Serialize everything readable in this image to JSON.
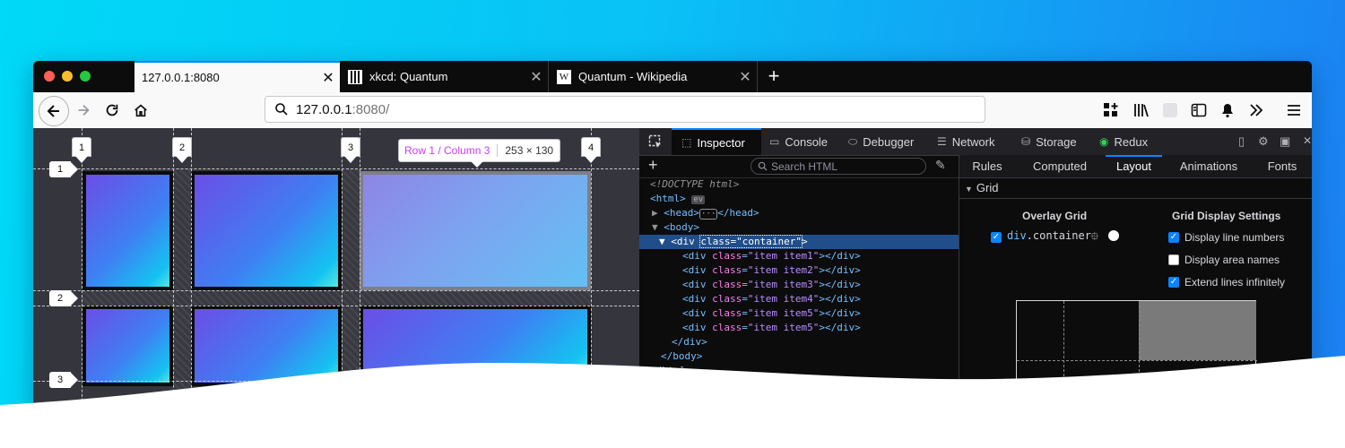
{
  "browser": {
    "tabs": [
      {
        "title": "127.0.0.1:8080",
        "active": true
      },
      {
        "title": "xkcd: Quantum",
        "active": false,
        "favicon": "xkcd-favicon"
      },
      {
        "title": "Quantum - Wikipedia",
        "active": false,
        "favicon": "wikipedia-favicon"
      }
    ],
    "tab_close_symbol": "✕",
    "new_tab_symbol": "+",
    "url_host": "127.0.0.1",
    "url_rest": ":8080/",
    "toolbar_icons": [
      "back-icon",
      "forward-icon",
      "reload-icon",
      "home-icon",
      "extensions-icon",
      "library-icon",
      "container-icon",
      "sidebar-icon",
      "notification-icon",
      "overflow-icon",
      "menu-icon"
    ]
  },
  "grid_overlay": {
    "column_lines": [
      "1",
      "2",
      "3",
      "4"
    ],
    "row_lines": [
      "1",
      "2",
      "3"
    ],
    "info_position": "Row 1 / Column 3",
    "info_size": "253 × 130"
  },
  "devtools": {
    "tabs": [
      {
        "label": "Inspector",
        "icon": "inspector-icon",
        "active": true
      },
      {
        "label": "Console",
        "icon": "console-icon"
      },
      {
        "label": "Debugger",
        "icon": "debugger-icon"
      },
      {
        "label": "Network",
        "icon": "network-icon"
      },
      {
        "label": "Storage",
        "icon": "storage-icon"
      },
      {
        "label": "Redux",
        "icon": "redux-icon"
      }
    ],
    "search_placeholder": "Search HTML",
    "markup": {
      "doctype": "<!DOCTYPE html>",
      "html_open": "<html>",
      "head": "<head>",
      "head_close": "</head>",
      "body_open": "<body>",
      "selected_div": "class=\"container\"",
      "items": [
        "\"item item1\"",
        "\"item item2\"",
        "\"item item3\"",
        "\"item item4\"",
        "\"item item5\"",
        "\"item item5\""
      ],
      "div_close": "</div>",
      "body_close": "</body>",
      "html_close": "</html>"
    },
    "side_tabs": [
      {
        "label": "Rules"
      },
      {
        "label": "Computed"
      },
      {
        "label": "Layout",
        "active": true
      },
      {
        "label": "Animations"
      },
      {
        "label": "Fonts"
      }
    ],
    "grid_section": "Grid",
    "overlay_title": "Overlay Grid",
    "overlay_item_tag": "div",
    "overlay_item_class": ".container",
    "overlay_item_checked": true,
    "overlay_color": "#ffffff",
    "settings_title": "Grid Display Settings",
    "settings": [
      {
        "label": "Display line numbers",
        "checked": true
      },
      {
        "label": "Display area names",
        "checked": false
      },
      {
        "label": "Extend lines infinitely",
        "checked": true
      }
    ]
  },
  "colors": {
    "accent": "#0a84ff",
    "tag": "#75bfff",
    "attr_name": "#ff7de9",
    "attr_value": "#b98eff",
    "overlay_info_text": "#c63ef0"
  }
}
